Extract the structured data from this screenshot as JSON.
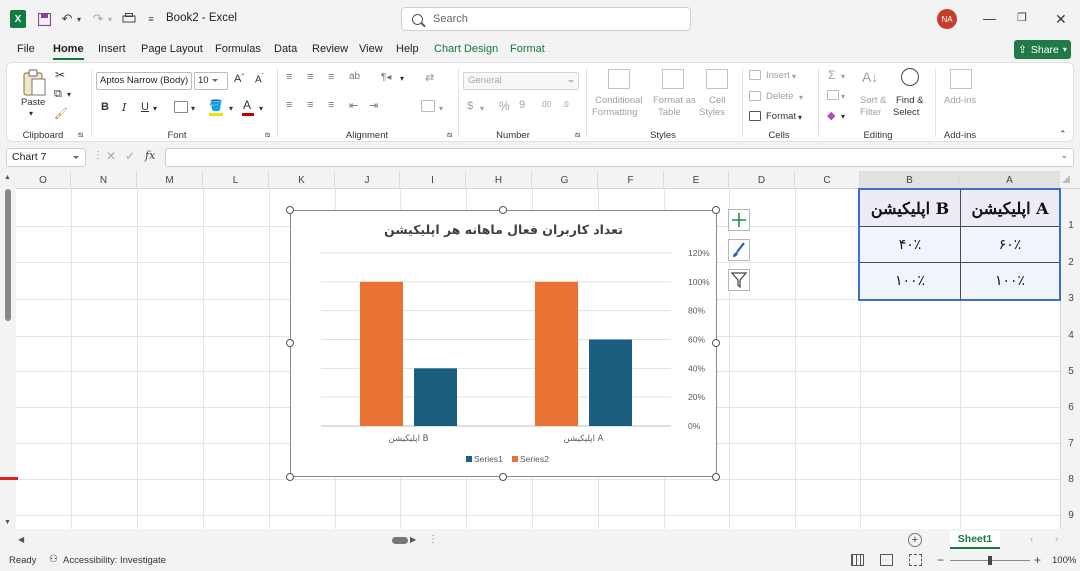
{
  "titlebar": {
    "doc_title": "Book2 - Excel",
    "search_placeholder": "Search",
    "avatar_initials": "NA"
  },
  "tabs": [
    "File",
    "Home",
    "Insert",
    "Page Layout",
    "Formulas",
    "Data",
    "Review",
    "View",
    "Help",
    "Chart Design",
    "Format"
  ],
  "share_label": "Share",
  "ribbon": {
    "paste_label": "Paste",
    "font_name": "Aptos Narrow (Body)",
    "font_size": "10",
    "number_format": "General",
    "groups": {
      "clipboard": "Clipboard",
      "font": "Font",
      "alignment": "Alignment",
      "number": "Number",
      "styles": "Styles",
      "cells": "Cells",
      "editing": "Editing",
      "addins": "Add-ins"
    },
    "styles": {
      "conditional1": "Conditional",
      "conditional2": "Formatting",
      "format_as1": "Format as",
      "format_as2": "Table",
      "cell_styles1": "Cell",
      "cell_styles2": "Styles"
    },
    "cells": {
      "insert": "Insert",
      "delete": "Delete",
      "format": "Format"
    },
    "editing": {
      "sort1": "Sort &",
      "sort2": "Filter",
      "find1": "Find &",
      "find2": "Select"
    },
    "addins_label": "Add-ins"
  },
  "namebox": "Chart 7",
  "columns": [
    "O",
    "N",
    "M",
    "L",
    "K",
    "J",
    "I",
    "H",
    "G",
    "F",
    "E",
    "D",
    "C",
    "B",
    "A"
  ],
  "rows": [
    "1",
    "2",
    "3",
    "4",
    "5",
    "6",
    "7",
    "8",
    "9"
  ],
  "table": {
    "header_b": "اپلیکیشن B",
    "header_a": "اپلیکیشن A",
    "r2_b": "۴۰٪",
    "r2_a": "۶۰٪",
    "r3_b": "۱۰۰٪",
    "r3_a": "۱۰۰٪"
  },
  "chart_data": {
    "type": "bar",
    "title": "تعداد کاربران فعال ماهانه هر اپلیکیشن",
    "categories": [
      "اپلیکیشن B",
      "اپلیکیشن A"
    ],
    "series": [
      {
        "name": "Series2",
        "values": [
          1.0,
          1.0
        ],
        "color": "#e97132"
      },
      {
        "name": "Series1",
        "values": [
          0.4,
          0.6
        ],
        "color": "#1b5e80"
      }
    ],
    "y_ticks": [
      "0%",
      "20%",
      "40%",
      "60%",
      "80%",
      "100%",
      "120%"
    ],
    "ylim": [
      0,
      1.2
    ],
    "legend": [
      "Series1",
      "Series2"
    ],
    "legend_position": "bottom",
    "y_axis_side": "right",
    "gridlines": true
  },
  "sheet_tab": "Sheet1",
  "status": {
    "ready": "Ready",
    "accessibility": "Accessibility: Investigate",
    "zoom": "100%"
  }
}
